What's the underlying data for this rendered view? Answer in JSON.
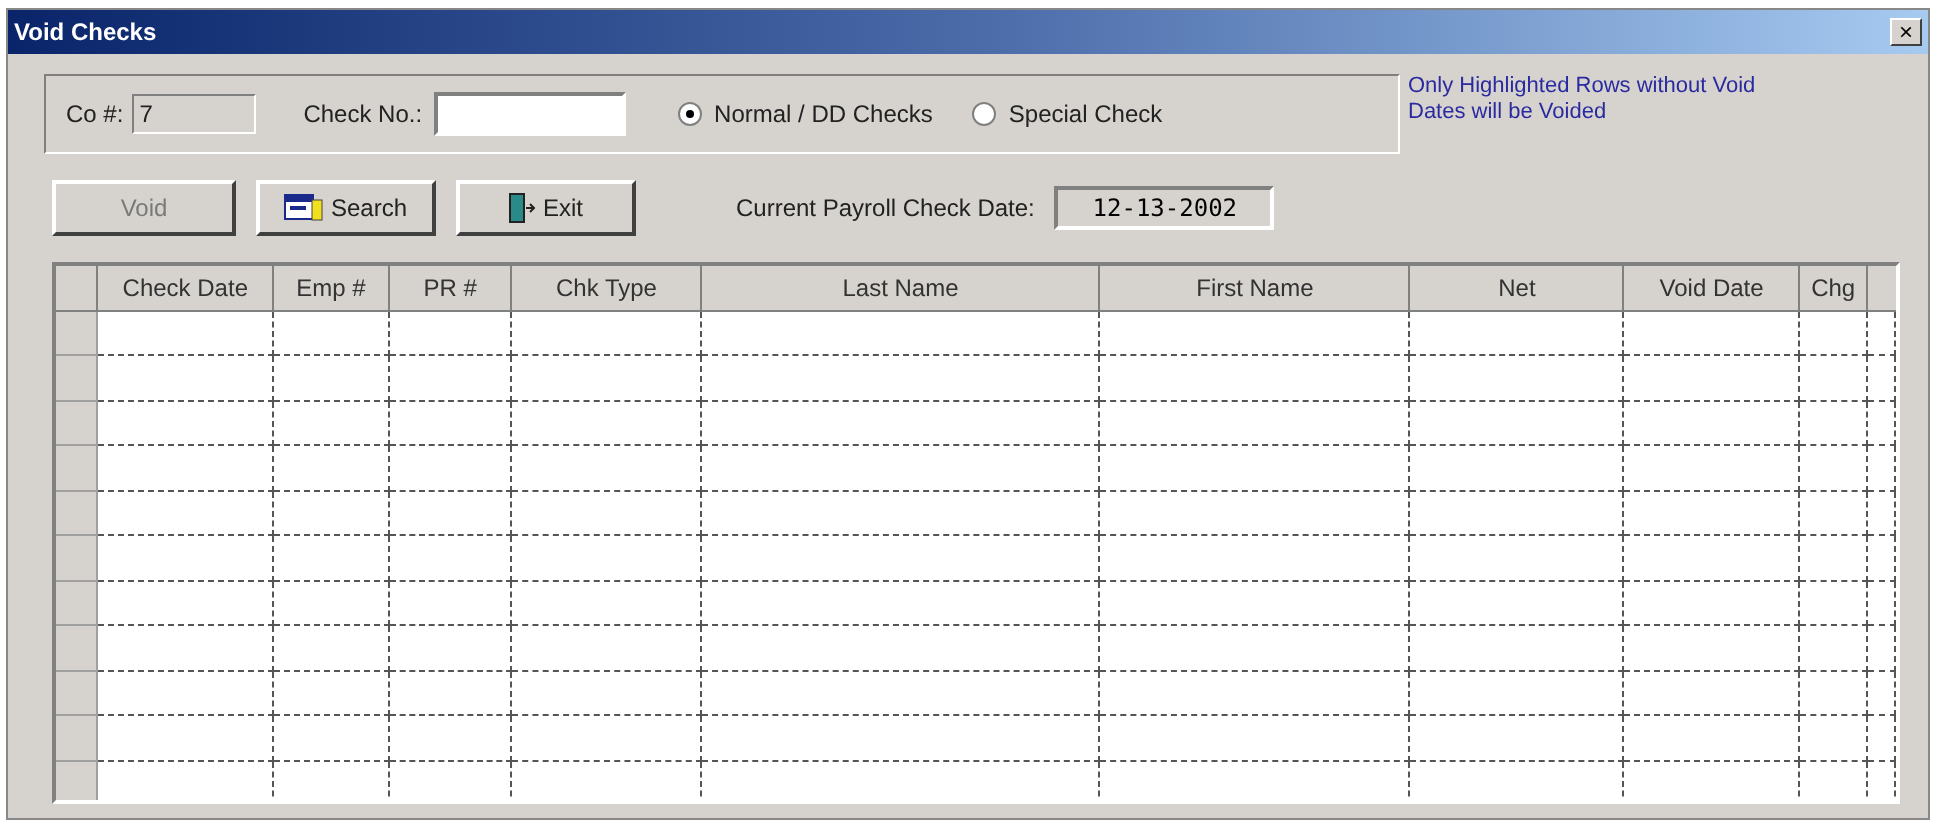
{
  "window": {
    "title": "Void Checks",
    "close": "×"
  },
  "filters": {
    "company_label": "Co #:",
    "company_value": "7",
    "check_no_label": "Check No.:",
    "check_types": [
      {
        "label": "Normal / DD Checks",
        "selected": true
      },
      {
        "label": "Special Check",
        "selected": false
      }
    ]
  },
  "note": "Only Highlighted Rows without Void Dates will be Voided",
  "buttons": [
    {
      "label": "Void",
      "kind": "void",
      "disabled": true
    },
    {
      "label": "Search",
      "kind": "search",
      "disabled": false
    },
    {
      "label": "Exit",
      "kind": "exit",
      "disabled": false
    }
  ],
  "payroll_date": {
    "label": "Current Payroll Check Date:",
    "value": "12-13-2002"
  },
  "table": {
    "columns": [
      "Check Date",
      "Emp #",
      "PR #",
      "Chk Type",
      "Last Name",
      "First Name",
      "Net",
      "Void Date",
      "Chg"
    ]
  }
}
